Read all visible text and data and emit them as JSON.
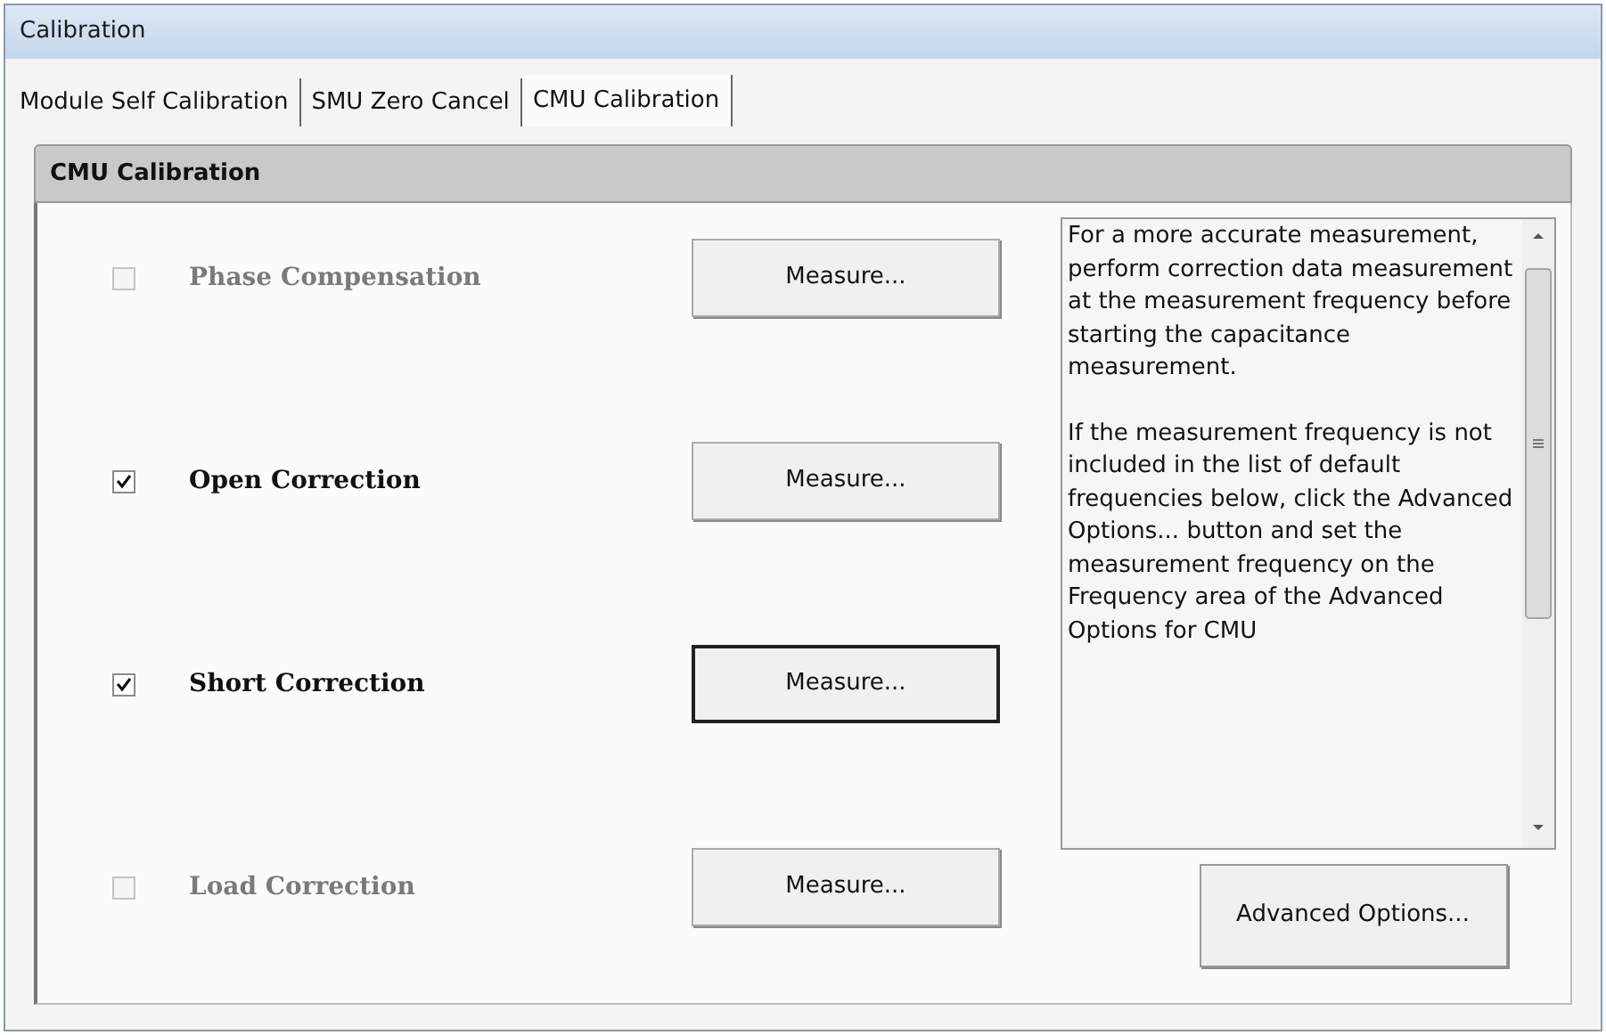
{
  "window": {
    "title": "Calibration"
  },
  "tabs": [
    {
      "label": "Module Self Calibration",
      "selected": false
    },
    {
      "label": "SMU Zero Cancel",
      "selected": false
    },
    {
      "label": "CMU Calibration",
      "selected": true
    }
  ],
  "group": {
    "title": "CMU Calibration",
    "items": [
      {
        "label": "Phase Compensation",
        "checked": false,
        "disabled": true,
        "button": "Measure...",
        "focused": false
      },
      {
        "label": "Open Correction",
        "checked": true,
        "disabled": false,
        "button": "Measure...",
        "focused": false
      },
      {
        "label": "Short Correction",
        "checked": true,
        "disabled": false,
        "button": "Measure...",
        "focused": true
      },
      {
        "label": "Load Correction",
        "checked": false,
        "disabled": true,
        "button": "Measure...",
        "focused": false
      }
    ],
    "help_text": [
      "For a more accurate measurement, perform correction data measurement at the measurement frequency before starting the capacitance measurement.",
      "If the measurement frequency is not included in the list of default frequencies below, click the Advanced Options... button and set the measurement frequency on the Frequency area of the Advanced Options for CMU"
    ],
    "advanced_button": "Advanced Options..."
  }
}
